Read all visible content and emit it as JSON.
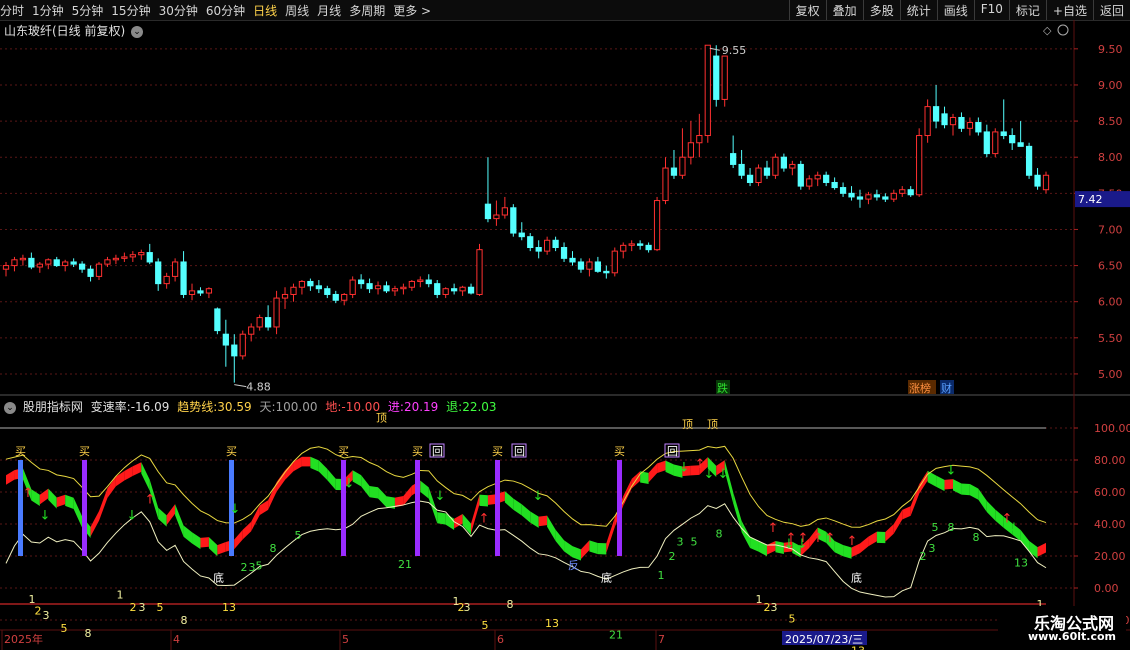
{
  "toolbar": {
    "periods": [
      "分时",
      "1分钟",
      "5分钟",
      "15分钟",
      "30分钟",
      "60分钟",
      "日线",
      "周线",
      "月线",
      "多周期",
      "更多 >"
    ],
    "active_period": "日线",
    "right_buttons": [
      "复权",
      "叠加",
      "多股",
      "统计",
      "画线",
      "F10",
      "标记",
      "+自选",
      "返回"
    ]
  },
  "stock": {
    "title": "山东玻纤(日线 前复权)",
    "high_label": "9.55",
    "low_label": "4.88",
    "current_price": "7.42",
    "tags": {
      "die": "跌",
      "zhangbang": "涨榜",
      "cai": "财"
    }
  },
  "price_axis": [
    "9.50",
    "9.00",
    "8.50",
    "8.00",
    "7.50",
    "7.00",
    "6.50",
    "6.00",
    "5.50",
    "5.00"
  ],
  "indicator": {
    "name": "股朋指标网",
    "bsl_label": "变速率:",
    "bsl": "-16.09",
    "qsx_label": "趋势线:",
    "qsx": "30.59",
    "tian_label": "天:",
    "tian": "100.00",
    "di_label": "地:",
    "di": "-10.00",
    "jin_label": "进:",
    "jin": "20.19",
    "tui_label": "退:",
    "tui": "22.03",
    "axis": [
      "100.00",
      "80.00",
      "60.00",
      "40.00",
      "20.00",
      "0.00",
      "-20.00"
    ],
    "signals": {
      "buy": "买",
      "back": "回",
      "top": "顶",
      "bottom": "底",
      "reverse": "反"
    },
    "counts": [
      "1",
      "2",
      "3",
      "5",
      "8",
      "13",
      "21"
    ]
  },
  "date_axis": {
    "year": "2025年",
    "m4": "4",
    "m5": "5",
    "m6": "6",
    "m7": "7",
    "cursor": "2025/07/23/三"
  },
  "watermark": {
    "line1": "乐淘公式网",
    "line2": "www.60lt.com"
  },
  "colors": {
    "up": "#ff3030",
    "down": "#54ffff",
    "buy_bar_blue": "#4a7bff",
    "buy_bar_purple": "#9a2cff",
    "band_up": "#ff1a1a",
    "band_down": "#22e022"
  },
  "chart_data": {
    "type": "candlestick",
    "price_range": [
      4.75,
      9.65
    ],
    "candles": [
      [
        6.45,
        6.55,
        6.35,
        6.5
      ],
      [
        6.5,
        6.62,
        6.42,
        6.58
      ],
      [
        6.58,
        6.65,
        6.5,
        6.6
      ],
      [
        6.6,
        6.68,
        6.45,
        6.48
      ],
      [
        6.48,
        6.55,
        6.4,
        6.52
      ],
      [
        6.52,
        6.6,
        6.45,
        6.58
      ],
      [
        6.58,
        6.62,
        6.48,
        6.5
      ],
      [
        6.5,
        6.58,
        6.42,
        6.55
      ],
      [
        6.55,
        6.6,
        6.48,
        6.52
      ],
      [
        6.52,
        6.56,
        6.4,
        6.45
      ],
      [
        6.45,
        6.5,
        6.28,
        6.35
      ],
      [
        6.35,
        6.55,
        6.3,
        6.52
      ],
      [
        6.52,
        6.62,
        6.48,
        6.58
      ],
      [
        6.58,
        6.65,
        6.52,
        6.6
      ],
      [
        6.6,
        6.68,
        6.55,
        6.62
      ],
      [
        6.62,
        6.7,
        6.55,
        6.65
      ],
      [
        6.65,
        6.72,
        6.58,
        6.68
      ],
      [
        6.68,
        6.8,
        6.52,
        6.55
      ],
      [
        6.55,
        6.6,
        6.15,
        6.25
      ],
      [
        6.25,
        6.4,
        6.18,
        6.35
      ],
      [
        6.35,
        6.6,
        6.28,
        6.55
      ],
      [
        6.55,
        6.7,
        6.05,
        6.1
      ],
      [
        6.1,
        6.25,
        6.02,
        6.15
      ],
      [
        6.15,
        6.2,
        6.08,
        6.12
      ],
      [
        6.12,
        6.2,
        6.05,
        6.18
      ],
      [
        5.9,
        5.92,
        5.55,
        5.6
      ],
      [
        5.55,
        5.75,
        5.1,
        5.4
      ],
      [
        5.4,
        5.55,
        4.88,
        5.25
      ],
      [
        5.25,
        5.6,
        5.2,
        5.55
      ],
      [
        5.55,
        5.7,
        5.45,
        5.65
      ],
      [
        5.65,
        5.82,
        5.6,
        5.78
      ],
      [
        5.78,
        5.95,
        5.6,
        5.65
      ],
      [
        5.65,
        6.15,
        5.55,
        6.05
      ],
      [
        6.05,
        6.2,
        5.9,
        6.1
      ],
      [
        6.1,
        6.25,
        6.0,
        6.2
      ],
      [
        6.2,
        6.3,
        6.1,
        6.28
      ],
      [
        6.28,
        6.32,
        6.15,
        6.22
      ],
      [
        6.22,
        6.3,
        6.12,
        6.18
      ],
      [
        6.18,
        6.22,
        6.05,
        6.1
      ],
      [
        6.1,
        6.15,
        5.98,
        6.02
      ],
      [
        6.02,
        6.12,
        5.95,
        6.1
      ],
      [
        6.1,
        6.35,
        6.05,
        6.3
      ],
      [
        6.3,
        6.38,
        6.18,
        6.25
      ],
      [
        6.25,
        6.32,
        6.12,
        6.18
      ],
      [
        6.18,
        6.28,
        6.1,
        6.22
      ],
      [
        6.22,
        6.28,
        6.12,
        6.15
      ],
      [
        6.15,
        6.22,
        6.08,
        6.18
      ],
      [
        6.18,
        6.25,
        6.1,
        6.2
      ],
      [
        6.2,
        6.3,
        6.15,
        6.28
      ],
      [
        6.28,
        6.35,
        6.2,
        6.3
      ],
      [
        6.3,
        6.38,
        6.2,
        6.25
      ],
      [
        6.25,
        6.3,
        6.05,
        6.1
      ],
      [
        6.1,
        6.2,
        6.05,
        6.18
      ],
      [
        6.18,
        6.25,
        6.1,
        6.15
      ],
      [
        6.15,
        6.22,
        6.08,
        6.2
      ],
      [
        6.2,
        6.25,
        6.1,
        6.12
      ],
      [
        6.1,
        6.8,
        6.08,
        6.72
      ],
      [
        7.35,
        8.0,
        7.1,
        7.15
      ],
      [
        7.15,
        7.4,
        7.05,
        7.2
      ],
      [
        7.2,
        7.45,
        7.15,
        7.3
      ],
      [
        7.3,
        7.35,
        6.9,
        6.95
      ],
      [
        6.95,
        7.1,
        6.85,
        6.9
      ],
      [
        6.9,
        6.95,
        6.7,
        6.75
      ],
      [
        6.75,
        6.85,
        6.6,
        6.7
      ],
      [
        6.7,
        6.9,
        6.65,
        6.85
      ],
      [
        6.85,
        6.9,
        6.7,
        6.75
      ],
      [
        6.75,
        6.82,
        6.55,
        6.6
      ],
      [
        6.6,
        6.7,
        6.5,
        6.55
      ],
      [
        6.55,
        6.6,
        6.4,
        6.45
      ],
      [
        6.45,
        6.6,
        6.35,
        6.55
      ],
      [
        6.55,
        6.62,
        6.4,
        6.42
      ],
      [
        6.42,
        6.5,
        6.32,
        6.4
      ],
      [
        6.4,
        6.75,
        6.35,
        6.7
      ],
      [
        6.7,
        6.82,
        6.6,
        6.78
      ],
      [
        6.78,
        6.85,
        6.7,
        6.8
      ],
      [
        6.8,
        6.85,
        6.72,
        6.78
      ],
      [
        6.78,
        6.82,
        6.68,
        6.72
      ],
      [
        6.72,
        7.45,
        6.7,
        7.4
      ],
      [
        7.4,
        8.0,
        7.35,
        7.85
      ],
      [
        7.85,
        8.1,
        7.7,
        7.75
      ],
      [
        7.75,
        8.4,
        7.7,
        8.0
      ],
      [
        8.0,
        8.5,
        7.9,
        8.2
      ],
      [
        8.2,
        8.6,
        8.0,
        8.3
      ],
      [
        8.3,
        9.55,
        8.2,
        9.55
      ],
      [
        9.4,
        9.55,
        8.7,
        8.8
      ],
      [
        8.8,
        9.4,
        8.7,
        9.4
      ],
      [
        8.05,
        8.3,
        7.85,
        7.9
      ],
      [
        7.9,
        8.1,
        7.7,
        7.75
      ],
      [
        7.75,
        7.85,
        7.6,
        7.65
      ],
      [
        7.65,
        7.9,
        7.6,
        7.85
      ],
      [
        7.85,
        7.95,
        7.7,
        7.75
      ],
      [
        7.75,
        8.05,
        7.7,
        8.0
      ],
      [
        8.0,
        8.05,
        7.8,
        7.85
      ],
      [
        7.85,
        7.95,
        7.75,
        7.9
      ],
      [
        7.9,
        7.95,
        7.55,
        7.6
      ],
      [
        7.6,
        7.75,
        7.55,
        7.7
      ],
      [
        7.7,
        7.8,
        7.6,
        7.75
      ],
      [
        7.75,
        7.8,
        7.6,
        7.65
      ],
      [
        7.65,
        7.72,
        7.55,
        7.58
      ],
      [
        7.58,
        7.65,
        7.45,
        7.5
      ],
      [
        7.5,
        7.6,
        7.4,
        7.45
      ],
      [
        7.45,
        7.55,
        7.3,
        7.42
      ],
      [
        7.42,
        7.52,
        7.35,
        7.48
      ],
      [
        7.48,
        7.55,
        7.4,
        7.45
      ],
      [
        7.45,
        7.5,
        7.38,
        7.42
      ],
      [
        7.42,
        7.55,
        7.38,
        7.5
      ],
      [
        7.5,
        7.6,
        7.45,
        7.55
      ],
      [
        7.55,
        7.6,
        7.45,
        7.48
      ],
      [
        7.48,
        8.4,
        7.45,
        8.3
      ],
      [
        8.3,
        8.8,
        8.2,
        8.7
      ],
      [
        8.7,
        9.0,
        8.4,
        8.5
      ],
      [
        8.6,
        8.7,
        8.4,
        8.45
      ],
      [
        8.45,
        8.6,
        8.3,
        8.55
      ],
      [
        8.55,
        8.62,
        8.35,
        8.4
      ],
      [
        8.4,
        8.55,
        8.3,
        8.48
      ],
      [
        8.48,
        8.55,
        8.3,
        8.35
      ],
      [
        8.35,
        8.45,
        8.0,
        8.05
      ],
      [
        8.05,
        8.4,
        8.0,
        8.35
      ],
      [
        8.35,
        8.8,
        8.25,
        8.3
      ],
      [
        8.3,
        8.4,
        8.1,
        8.2
      ],
      [
        8.2,
        8.5,
        8.15,
        8.15
      ],
      [
        8.15,
        8.2,
        7.7,
        7.75
      ],
      [
        7.75,
        7.85,
        7.55,
        7.6
      ],
      [
        7.55,
        7.8,
        7.5,
        7.75
      ]
    ],
    "indicator_range": [
      -25,
      110
    ],
    "tian_line": 100,
    "di_line": -10
  }
}
